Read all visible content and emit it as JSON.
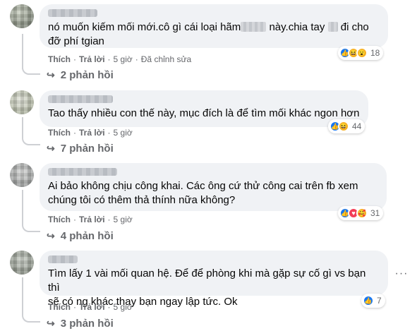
{
  "comments": [
    {
      "text_parts": [
        "nó muốn kiếm mối mới.cô gì cái loại hãm",
        "này.chia tay",
        "đi cho\nđỡ phí tgian"
      ],
      "reaction_count": "18",
      "actions": {
        "like": "Thích",
        "reply": "Trả lời",
        "time": "5 giờ",
        "edited": "Đã chỉnh sửa"
      },
      "replies": "2 phản hồi"
    },
    {
      "text": "Tao thấy nhiều con thế này, mục đích là để tìm mối khác ngon hơn",
      "reaction_count": "44",
      "actions": {
        "like": "Thích",
        "reply": "Trả lời",
        "time": "5 giờ"
      },
      "replies": "7 phản hồi"
    },
    {
      "text": "Ai bảo không chịu công khai. Các ông cứ thử công cai trên fb xem\nchúng tôi có thêm thả thính nữa không?",
      "reaction_count": "31",
      "actions": {
        "like": "Thích",
        "reply": "Trả lời",
        "time": "5 giờ"
      },
      "replies": "4 phản hồi"
    },
    {
      "text": "Tìm lấy 1 vài mối quan hệ. Để để phòng khi mà gặp sự cố gì vs bạn thì\nsẽ có ng khác thay bạn ngay lập tức. Ok",
      "reaction_count": "7",
      "actions": {
        "like": "Thích",
        "reply": "Trả lời",
        "time": "5 giờ"
      },
      "replies": "3 phản hồi"
    }
  ],
  "icons": {
    "reaction_like": "like-icon",
    "reaction_haha": "haha-icon",
    "reaction_wow": "wow-icon",
    "reaction_love": "love-icon",
    "reaction_care": "care-icon",
    "reply_arrow": "reply-arrow-icon",
    "more": "more-options-icon"
  },
  "colors": {
    "bubble": "#f0f2f5",
    "secondary_text": "#65676b",
    "like_blue": "#1877f2",
    "love_red": "#f33e58",
    "haha_yellow": "#f7b125"
  }
}
